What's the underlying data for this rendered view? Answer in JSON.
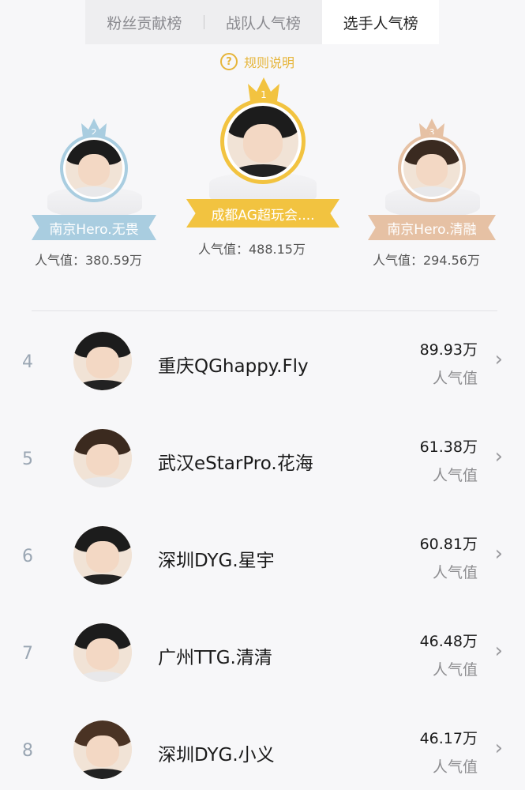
{
  "tabs": [
    {
      "label": "粉丝贡献榜"
    },
    {
      "label": "战队人气榜"
    },
    {
      "label": "选手人气榜"
    }
  ],
  "rules_label": "规则说明",
  "rules_icon": "?",
  "podium": {
    "first": {
      "rank": "1",
      "name": "成都AG超玩会....",
      "popularity": "人气值：488.15万"
    },
    "second": {
      "rank": "2",
      "name": "南京Hero.无畏",
      "popularity": "人气值：380.59万"
    },
    "third": {
      "rank": "3",
      "name": "南京Hero.清融",
      "popularity": "人气值：294.56万"
    }
  },
  "list": [
    {
      "rank": "4",
      "name": "重庆QGhappy.Fly",
      "value": "89.93万",
      "label": "人气值"
    },
    {
      "rank": "5",
      "name": "武汉eStarPro.花海",
      "value": "61.38万",
      "label": "人气值"
    },
    {
      "rank": "6",
      "name": "深圳DYG.星宇",
      "value": "60.81万",
      "label": "人气值"
    },
    {
      "rank": "7",
      "name": "广州TTG.清清",
      "value": "46.48万",
      "label": "人气值"
    },
    {
      "rank": "8",
      "name": "深圳DYG.小义",
      "value": "46.17万",
      "label": "人气值"
    }
  ],
  "chevron": "›",
  "colors": {
    "gold": "#f2c340",
    "silver": "#a9cde0",
    "bronze": "#e6c1a4",
    "rank_text": "#9aa6b3"
  }
}
